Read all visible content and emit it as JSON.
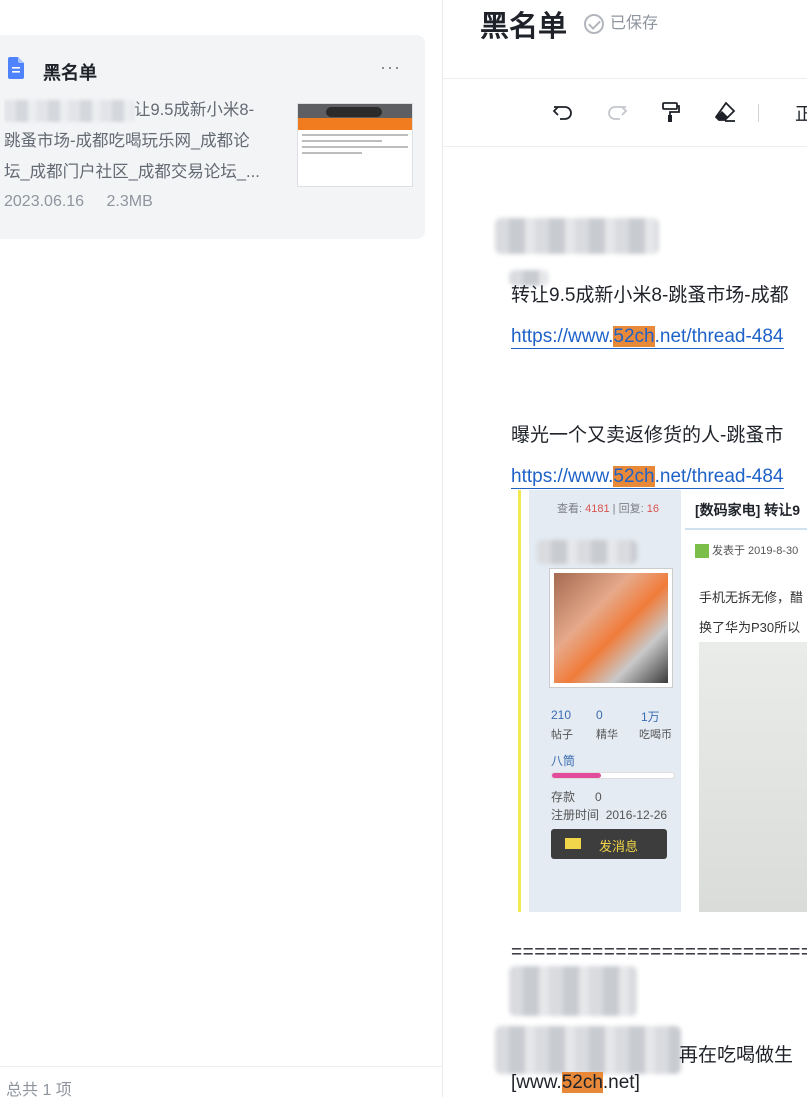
{
  "sidebar": {
    "card": {
      "title": "黑名单",
      "more": "···",
      "snippet_line1": "让9.5成新小米8-",
      "snippet_line2": "跳蚤市场-成都吃喝玩乐网_成都论",
      "snippet_line3": "坛_成都门户社区_成都交易论坛_...",
      "date": "2023.06.16",
      "size": "2.3MB"
    },
    "footer": "总共 1 项"
  },
  "doc": {
    "title": "黑名单",
    "saved": "已保存",
    "toolbar": {
      "undo_icon": "undo-icon",
      "redo_icon": "redo-icon",
      "format_painter_icon": "format-painter-icon",
      "eraser_icon": "eraser-icon",
      "cut_char": "正"
    },
    "para1": "转让9.5成新小米8-跳蚤市场-成都",
    "link1_pre": "https://www.",
    "link1_hl": "52ch",
    "link1_post": ".net/thread-484",
    "para2": "曝光一个又卖返修货的人-跳蚤市",
    "link2_pre": "https://www.",
    "link2_hl": "52ch",
    "link2_post": ".net/thread-484",
    "screenshot": {
      "stats_view_label": "查看:",
      "stats_view": "4181",
      "stats_reply_label": "回复:",
      "stats_reply": "16",
      "posts_num": "210",
      "posts_label": "帖子",
      "digest_num": "0",
      "digest_label": "精华",
      "coins_num": "1万",
      "coins_label": "吃喝币",
      "rank": "八筒",
      "deposit_label": "存款",
      "deposit_value": "0",
      "reg_label": "注册时间",
      "reg_value": "2016-12-26",
      "msg_button": "发消息",
      "head": "[数码家电] 转让9",
      "posted": "发表于 2019-8-30",
      "body1": "手机无拆无修，醋",
      "body2": "换了华为P30所以"
    },
    "divider": "===========================",
    "para3_tail": "再在吃喝做生",
    "link3_pre": "[www.",
    "link3_hl": "52ch",
    "link3_post": ".net]"
  }
}
